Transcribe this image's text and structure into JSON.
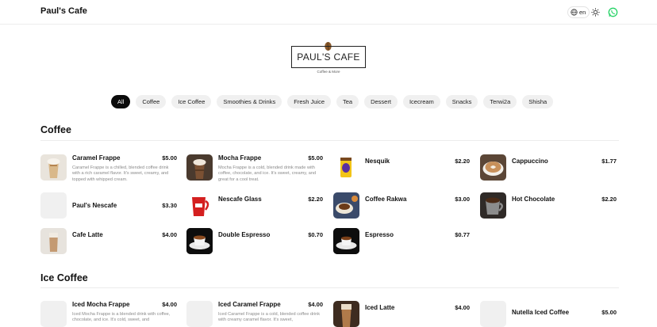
{
  "header": {
    "brand": "Paul's Cafe",
    "lang": "en"
  },
  "logo": {
    "text": "PAUL'S CAFE",
    "tagline": "Coffee & More"
  },
  "categories": [
    "All",
    "Coffee",
    "Ice Coffee",
    "Smoothies & Drinks",
    "Fresh Juice",
    "Tea",
    "Dessert",
    "Icecream",
    "Snacks",
    "Terwi2a",
    "Shisha"
  ],
  "sections": {
    "coffee": {
      "title": "Coffee",
      "items": [
        {
          "name": "Caramel Frappe",
          "price": "$5.00",
          "desc": "Caramel Frappe is a chilled, blended coffee drink with a rich caramel flavor. It's sweet, creamy, and topped with whipped cream."
        },
        {
          "name": "Mocha Frappe",
          "price": "$5.00",
          "desc": "Mocha Frappe is a cold, blended drink made with coffee, chocolate, and ice. It's sweet, creamy, and great for a cool treat."
        },
        {
          "name": "Nesquik",
          "price": "$2.20"
        },
        {
          "name": "Cappuccino",
          "price": "$1.77"
        },
        {
          "name": "Paul's Nescafe",
          "price": "$3.30"
        },
        {
          "name": "Nescafe Glass",
          "price": "$2.20"
        },
        {
          "name": "Coffee Rakwa",
          "price": "$3.00"
        },
        {
          "name": "Hot Chocolate",
          "price": "$2.20"
        },
        {
          "name": "Cafe Latte",
          "price": "$4.00"
        },
        {
          "name": "Double Espresso",
          "price": "$0.70"
        },
        {
          "name": "Espresso",
          "price": "$0.77"
        }
      ]
    },
    "ice_coffee": {
      "title": "Ice Coffee",
      "items": [
        {
          "name": "Iced Mocha Frappe",
          "price": "$4.00",
          "desc": "Iced Mocha Frappe is a blended drink with coffee, chocolate, and ice. It's cold, sweet, and"
        },
        {
          "name": "Iced Caramel Frappe",
          "price": "$4.00",
          "desc": "Iced Caramel Frappe is a cold, blended coffee drink with creamy caramel flavor. It's sweet,"
        },
        {
          "name": "Iced Latte",
          "price": "$4.00"
        },
        {
          "name": "Nutella Iced Coffee",
          "price": "$5.00"
        }
      ]
    }
  },
  "colors": {
    "accent": "#0b0b0b",
    "pill_bg": "#f0f0f0",
    "whatsapp": "#25d366"
  },
  "icons": [
    "globe-icon",
    "sun-icon",
    "whatsapp-icon",
    "coffee-bean-icon"
  ]
}
